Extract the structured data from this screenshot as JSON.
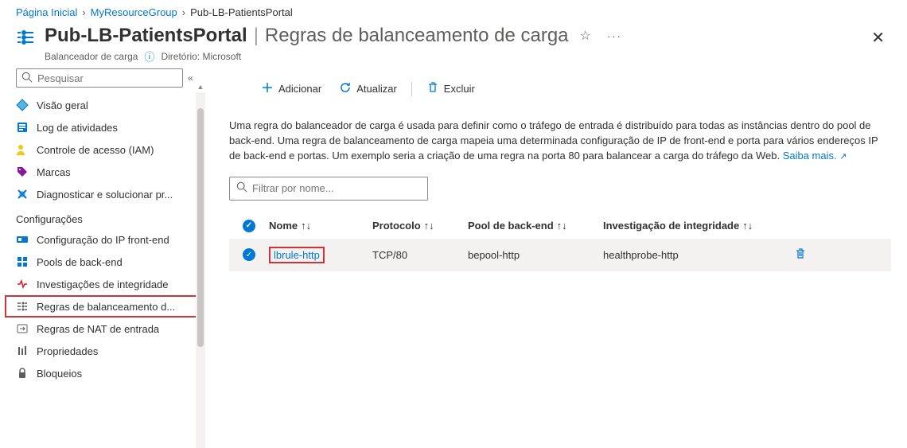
{
  "breadcrumb": {
    "items": [
      "Página Inicial",
      "MyResourceGroup",
      "Pub-LB-PatientsPortal"
    ]
  },
  "header": {
    "title_main": "Pub-LB-PatientsPortal",
    "title_divider": "|",
    "title_section": "Regras de balanceamento de carga",
    "resource_type": "Balanceador de carga",
    "directory_label": "Diretório: Microsoft"
  },
  "search": {
    "placeholder": "Pesquisar"
  },
  "nav": {
    "items_top": [
      {
        "label": "Visão geral",
        "icon": "overview"
      },
      {
        "label": "Log de atividades",
        "icon": "activity"
      },
      {
        "label": "Controle de acesso (IAM)",
        "icon": "access"
      },
      {
        "label": "Marcas",
        "icon": "tags"
      },
      {
        "label": "Diagnosticar e solucionar pr...",
        "icon": "diagnose"
      }
    ],
    "section_settings": "Configurações",
    "items_settings": [
      {
        "label": "Configuração do IP front-end",
        "icon": "frontend"
      },
      {
        "label": "Pools de back-end",
        "icon": "backend"
      },
      {
        "label": "Investigações de integridade",
        "icon": "probe"
      },
      {
        "label": "Regras de balanceamento d...",
        "icon": "lbrules",
        "highlighted": true
      },
      {
        "label": "Regras de NAT de entrada",
        "icon": "nat"
      },
      {
        "label": "Propriedades",
        "icon": "props"
      },
      {
        "label": "Bloqueios",
        "icon": "locks"
      }
    ]
  },
  "toolbar": {
    "add": "Adicionar",
    "refresh": "Atualizar",
    "delete": "Excluir"
  },
  "description": {
    "text": "Uma regra do balanceador de carga é usada para definir como o tráfego de entrada é distribuído para todas as instâncias dentro do pool de back-end. Uma regra de balanceamento de carga mapeia uma determinada configuração de IP de front-end e porta para vários endereços IP de back-end e portas. Um exemplo seria a criação de uma regra na porta 80 para balancear a carga do tráfego da Web.",
    "learn_more": "Saiba mais."
  },
  "filter": {
    "placeholder": "Filtrar por nome..."
  },
  "table": {
    "headers": {
      "name": "Nome",
      "protocol": "Protocolo",
      "pool": "Pool de back-end",
      "probe": "Investigação de integridade"
    },
    "rows": [
      {
        "name": "lbrule-http",
        "protocol": "TCP/80",
        "pool": "bepool-http",
        "probe": "healthprobe-http"
      }
    ]
  }
}
